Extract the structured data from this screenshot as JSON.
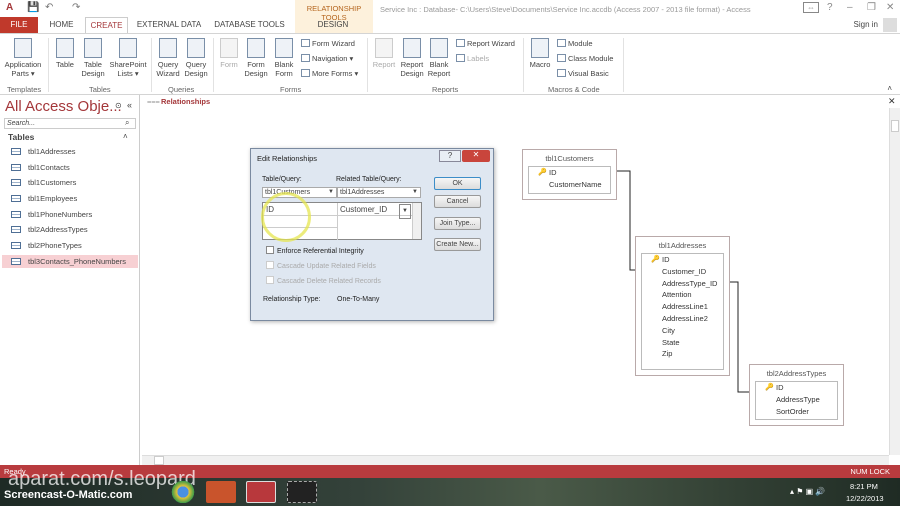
{
  "window": {
    "title": "Service Inc : Database- C:\\Users\\Steve\\Documents\\Service Inc.accdb (Access 2007 - 2013 file format) - Access",
    "context_tab_group": "RELATIONSHIP TOOLS",
    "sign_in": "Sign in",
    "controls": [
      "?",
      "–",
      "❐",
      "✕"
    ]
  },
  "tabs": [
    "FILE",
    "HOME",
    "CREATE",
    "EXTERNAL DATA",
    "DATABASE TOOLS",
    "DESIGN"
  ],
  "ribbon": {
    "templates": {
      "label": "Templates",
      "buttons": [
        "Application Parts ▾"
      ]
    },
    "tables": {
      "label": "Tables",
      "buttons": [
        "Table",
        "Table Design",
        "SharePoint Lists ▾"
      ]
    },
    "queries": {
      "label": "Queries",
      "buttons": [
        "Query Wizard",
        "Query Design"
      ]
    },
    "forms": {
      "label": "Forms",
      "buttons": [
        "Form",
        "Form Design",
        "Blank Form"
      ],
      "small": [
        "Form Wizard",
        "Navigation ▾",
        "More Forms ▾"
      ]
    },
    "reports": {
      "label": "Reports",
      "buttons": [
        "Report",
        "Report Design",
        "Blank Report"
      ],
      "small": [
        "Report Wizard",
        "Labels"
      ]
    },
    "macros": {
      "label": "Macros & Code",
      "buttons": [
        "Macro"
      ],
      "small": [
        "Module",
        "Class Module",
        "Visual Basic"
      ]
    }
  },
  "nav": {
    "title": "All Access Obje...",
    "search_placeholder": "Search...",
    "section": "Tables",
    "items": [
      "tbl1Addresses",
      "tbl1Contacts",
      "tbl1Customers",
      "tbl1Employees",
      "tbl1PhoneNumbers",
      "tbl2AddressTypes",
      "tbl2PhoneTypes",
      "tbl3Contacts_PhoneNumbers"
    ],
    "selected": "tbl3Contacts_PhoneNumbers"
  },
  "document": {
    "tab": "Relationships"
  },
  "diagram": {
    "tables": [
      {
        "name": "tbl1Customers",
        "fields": [
          "ID",
          "CustomerName"
        ],
        "key": "ID"
      },
      {
        "name": "tbl1Addresses",
        "fields": [
          "ID",
          "Customer_ID",
          "AddressType_ID",
          "Attention",
          "AddressLine1",
          "AddressLine2",
          "City",
          "State",
          "Zip"
        ],
        "key": "ID"
      },
      {
        "name": "tbl2AddressTypes",
        "fields": [
          "ID",
          "AddressType",
          "SortOrder"
        ],
        "key": "ID"
      }
    ]
  },
  "dialog": {
    "title": "Edit Relationships",
    "table_label": "Table/Query:",
    "related_label": "Related Table/Query:",
    "table_value": "tbl1Customers",
    "related_value": "tbl1Addresses",
    "field_left": "ID",
    "field_right": "Customer_ID",
    "ok": "OK",
    "cancel": "Cancel",
    "join_type": "Join Type...",
    "create_new": "Create New...",
    "enforce": "Enforce Referential Integrity",
    "cascade_update": "Cascade Update Related Fields",
    "cascade_delete": "Cascade Delete Related Records",
    "rel_type_label": "Relationship Type:",
    "rel_type_value": "One-To-Many"
  },
  "status": {
    "left": "Ready",
    "right": "NUM LOCK"
  },
  "taskbar": {
    "watermark": "aparat.com/s.leopard",
    "recorder": "Screencast-O-Matic.com",
    "time": "8:21 PM",
    "date": "12/22/2013"
  }
}
